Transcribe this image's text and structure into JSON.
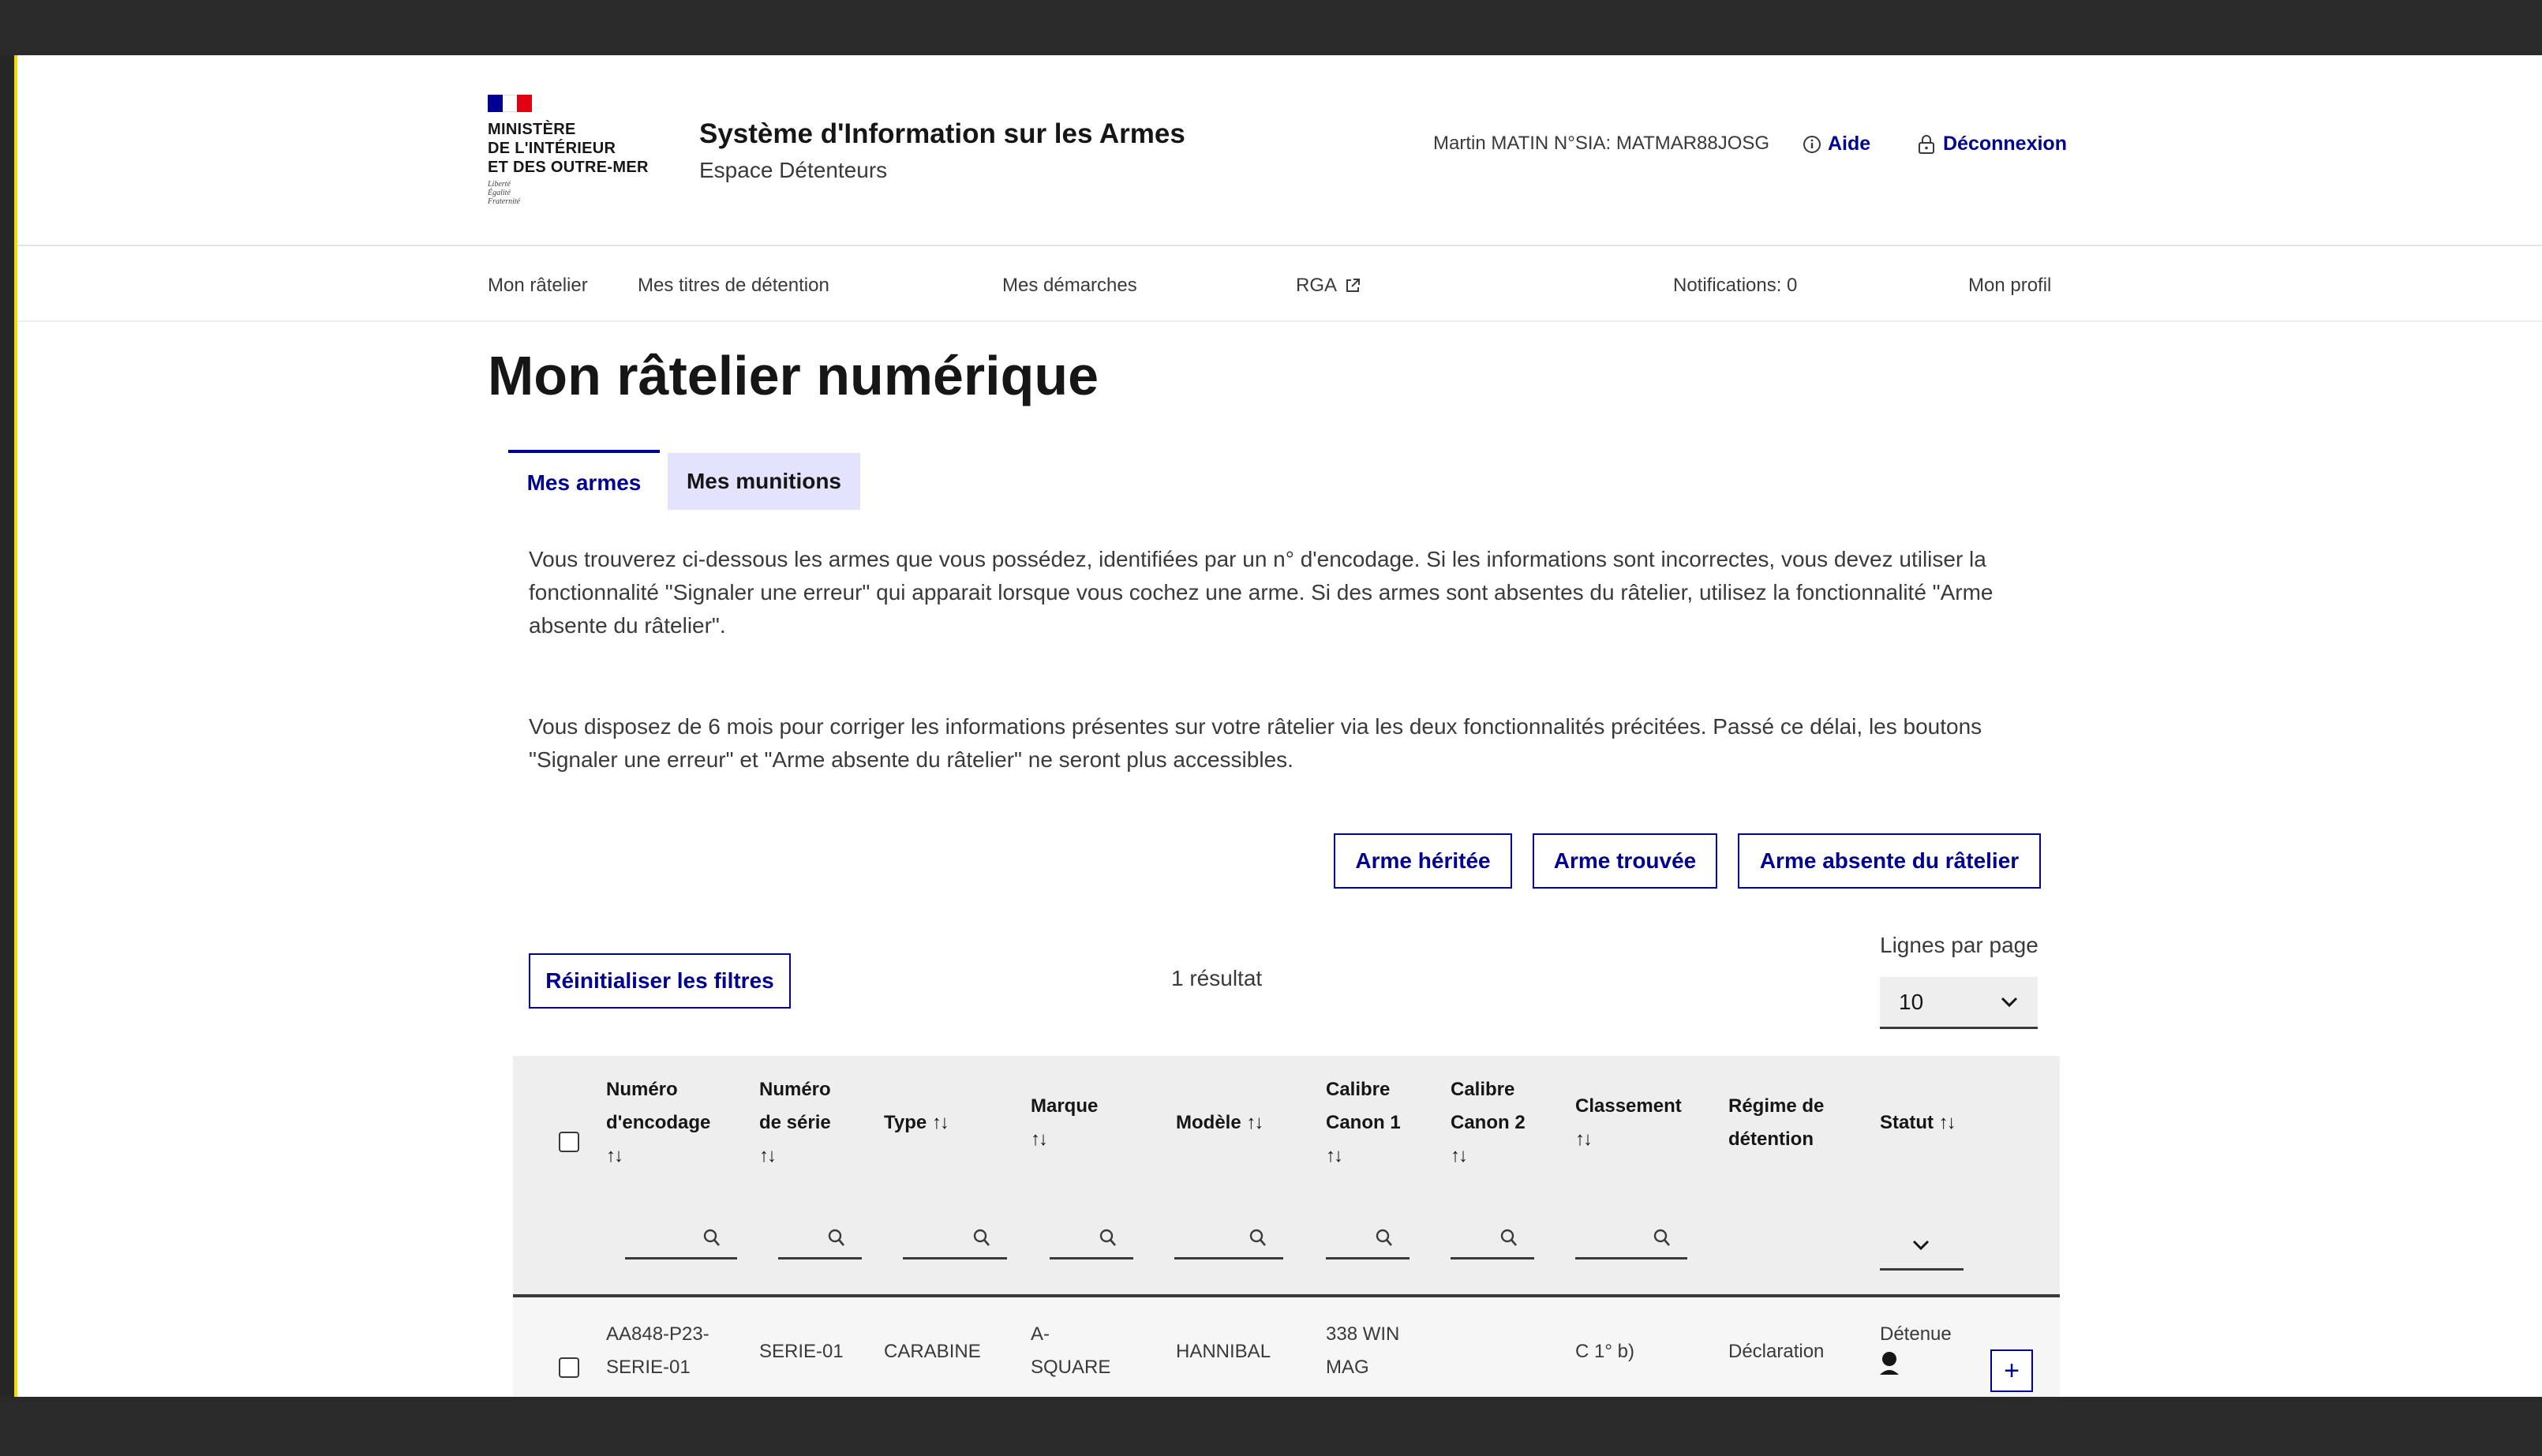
{
  "header": {
    "ministry_lines": [
      "MINISTÈRE",
      "DE L'INTÉRIEUR",
      "ET DES OUTRE-MER"
    ],
    "motto_lines": [
      "Liberté",
      "Égalité",
      "Fraternité"
    ],
    "system_title": "Système d'Information sur les Armes",
    "system_subtitle": "Espace Détenteurs",
    "user_info": "Martin MATIN N°SIA: MATMAR88JOSG",
    "help_label": "Aide",
    "logout_label": "Déconnexion",
    "colors": {
      "flag_blue": "#000091",
      "flag_red": "#e1000f",
      "accent": "#000091"
    }
  },
  "nav": {
    "items": [
      {
        "label": "Mon râtelier"
      },
      {
        "label": "Mes titres de détention"
      },
      {
        "label": "Mes démarches"
      },
      {
        "label": "RGA",
        "icon": "external-link-icon"
      },
      {
        "label": "Notifications: 0"
      },
      {
        "label": "Mon profil"
      }
    ]
  },
  "main": {
    "title": "Mon râtelier numérique",
    "tabs": [
      {
        "label": "Mes armes",
        "active": true
      },
      {
        "label": "Mes munitions",
        "active": false
      }
    ],
    "intro_1": "Vous trouverez ci-dessous les armes que vous possédez, identifiées par un n° d'encodage. Si les informations sont incorrectes, vous devez utiliser la fonctionnalité \"Signaler une erreur\" qui apparait lorsque vous cochez une arme. Si des armes sont absentes du râtelier, utilisez la fonctionnalité \"Arme absente du râtelier\".",
    "intro_2": "Vous disposez de 6 mois pour corriger les informations présentes sur votre râtelier via les deux fonctionnalités précitées. Passé ce délai, les boutons \"Signaler une erreur\" et \"Arme absente du râtelier\" ne seront plus accessibles.",
    "actions": {
      "inherited": "Arme héritée",
      "found": "Arme trouvée",
      "absent": "Arme absente du râtelier"
    },
    "reset_filters": "Réinitialiser les filtres",
    "results_count": "1 résultat",
    "rows_per_page_label": "Lignes par page",
    "rows_per_page_value": "10"
  },
  "table": {
    "sort_symbol": "↑↓",
    "columns": {
      "encoding_l1": "Numéro",
      "encoding_l2": "d'encodage",
      "serial_l1": "Numéro",
      "serial_l2": "de série",
      "type": "Type",
      "brand": "Marque",
      "model": "Modèle",
      "cal1_l1": "Calibre",
      "cal1_l2": "Canon 1",
      "cal2_l1": "Calibre",
      "cal2_l2": "Canon 2",
      "class": "Classement",
      "regime_l1": "Régime de",
      "regime_l2": "détention",
      "status": "Statut"
    },
    "rows": [
      {
        "encoding_l1": "AA848-P23-",
        "encoding_l2": "SERIE-01",
        "serial": "SERIE-01",
        "type": "CARABINE",
        "brand_l1": "A-",
        "brand_l2": "SQUARE",
        "model": "HANNIBAL",
        "cal1_l1": "338 WIN",
        "cal1_l2": "MAG",
        "cal2": "",
        "class": "C 1° b)",
        "regime": "Déclaration",
        "status": "Détenue",
        "expand": "+"
      }
    ]
  }
}
